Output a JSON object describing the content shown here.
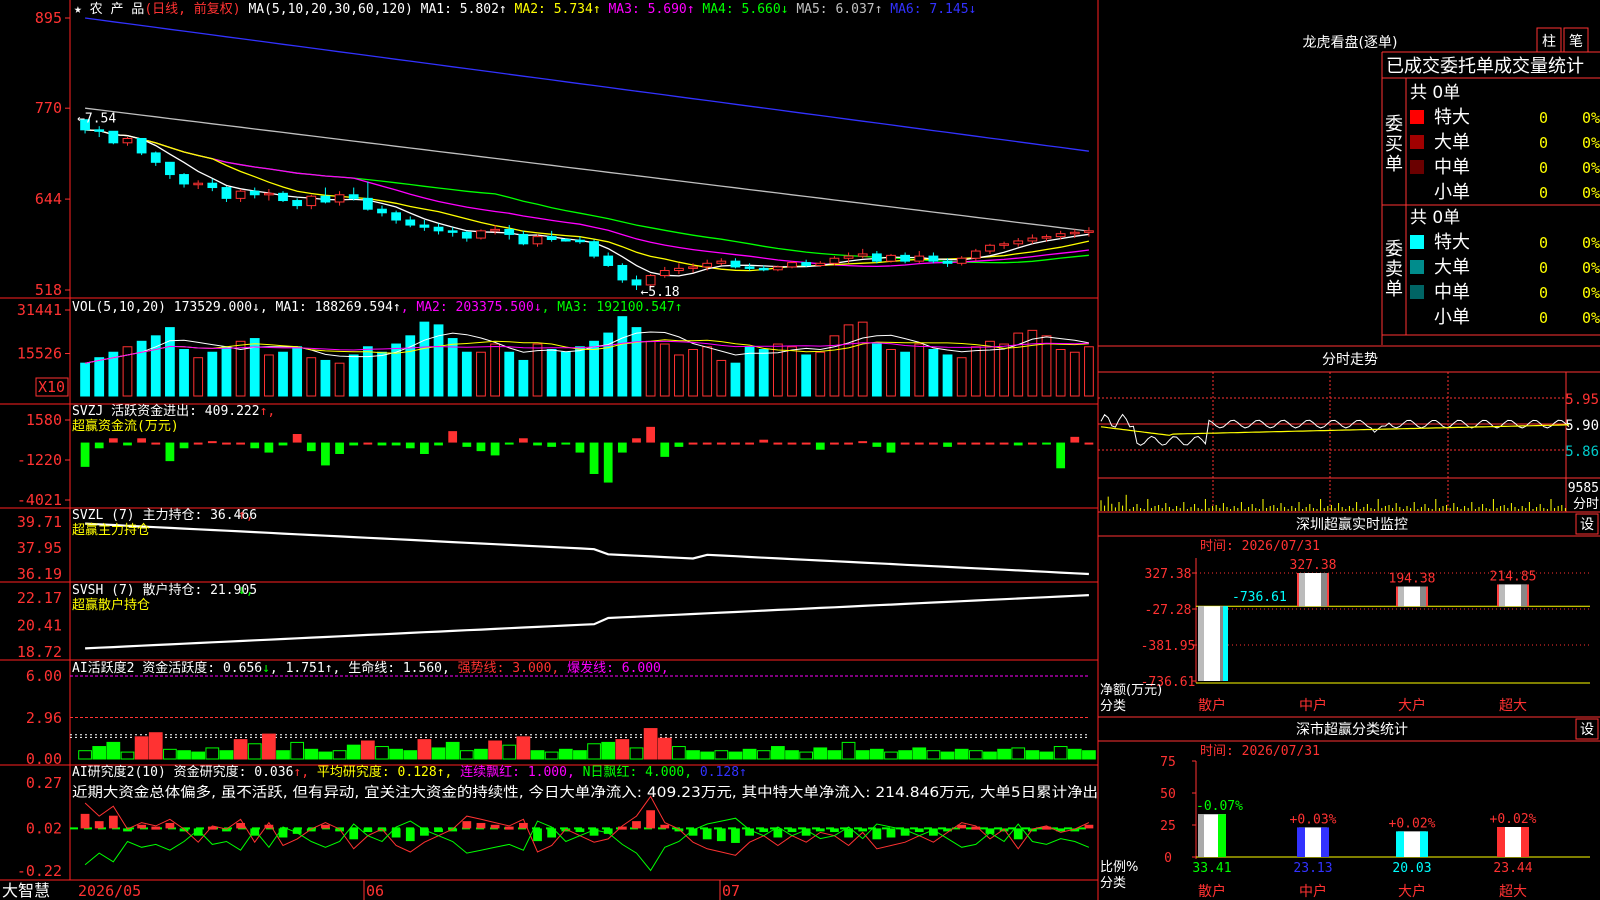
{
  "colors": {
    "up": "#ff3232",
    "down": "#00ffff",
    "red": "#ff3232",
    "grid": "#a00000",
    "yellow": "#ffff00",
    "magenta": "#ff00ff",
    "green": "#00ff00",
    "blue": "#3232ff",
    "white": "#ffffff",
    "gray": "#c0c0c0",
    "border": "#ff2020"
  },
  "main": {
    "header": {
      "mark": "★",
      "title": "农  产  品",
      "period": "(日线, 前复权)",
      "ma_def": "MA(5,10,20,30,60,120)",
      "ma1": "MA1: 5.802",
      "ma2": "MA2: 5.734",
      "ma3": "MA3: 5.690",
      "ma4": "MA4: 5.660",
      "ma5": "MA5: 6.037",
      "ma6": "MA6: 7.145"
    },
    "yticks": [
      "895",
      "770",
      "644",
      "518"
    ],
    "high_marker": "←7.54",
    "low_marker": "←5.18"
  },
  "vol": {
    "header": "VOL(5,10,20)",
    "value": "173529.000",
    "ma1": "MA1: 188269.594",
    "ma2": "MA2: 203375.500",
    "ma3": "MA3: 192100.547",
    "yticks": [
      "31441",
      "15526"
    ],
    "unit": "X10"
  },
  "svzj": {
    "header": "SVZJ  活跃资金进出: 409.222",
    "sub": "超赢资金流(万元)",
    "yticks": [
      "1580",
      "-1220",
      "-4021"
    ]
  },
  "svzl": {
    "header": "SVZL (7) 主力持仓: 36.466",
    "sub": "超赢主力持仓",
    "yticks": [
      "39.71",
      "37.95",
      "36.19"
    ]
  },
  "svsh": {
    "header": "SVSH (7) 散户持仓: 21.905",
    "sub": "超赢散户持仓",
    "yticks": [
      "22.17",
      "20.41",
      "18.72"
    ]
  },
  "ai1": {
    "header": "AI活跃度2 资金活跃度: 0.656",
    "v2": "1.751",
    "v3": "生命线: 1.560",
    "v4": "强势线: 3.000",
    "v5": "爆发线: 6.000",
    "yticks": [
      "6.00",
      "2.96",
      "0.00"
    ]
  },
  "ai2": {
    "header": "AI研究度2(10) 资金研究度: 0.036",
    "v2": "平均研究度: 0.128",
    "v3": "连续飘红: 1.000",
    "v4": "N日飘红: 4.000",
    "v5": "0.128",
    "note": "近期大资金总体偏多, 虽不活跃, 但有异动, 宜关注大资金的持续性, 今日大单净流入: 409.23万元, 其中特大单净流入: 214.846万元, 大单5日累计净出",
    "yticks": [
      "0.27",
      "0.02",
      "-0.22"
    ]
  },
  "xaxis": {
    "brand": "大智慧",
    "labels": [
      "2026/05",
      "06",
      "07"
    ]
  },
  "longhu": {
    "title": "龙虎看盘(逐单)",
    "tabs": [
      "柱",
      "笔"
    ],
    "subtitle": "已成交委托单成交量统计",
    "buy": {
      "side": "委买单",
      "total": "共 0单",
      "rows": [
        {
          "label": "特大",
          "val": "0",
          "pct": "0%",
          "color": "#ff0000"
        },
        {
          "label": "大单",
          "val": "0",
          "pct": "0%",
          "color": "#a00000"
        },
        {
          "label": "中单",
          "val": "0",
          "pct": "0%",
          "color": "#6a0000"
        },
        {
          "label": "小单",
          "val": "0",
          "pct": "0%",
          "color": "#000000"
        }
      ]
    },
    "sell": {
      "side": "委卖单",
      "total": "共 0单",
      "rows": [
        {
          "label": "特大",
          "val": "0",
          "pct": "0%",
          "color": "#00ffff"
        },
        {
          "label": "大单",
          "val": "0",
          "pct": "0%",
          "color": "#008c8c"
        },
        {
          "label": "中单",
          "val": "0",
          "pct": "0%",
          "color": "#006464"
        },
        {
          "label": "小单",
          "val": "0",
          "pct": "0%",
          "color": "#000000"
        }
      ]
    }
  },
  "fenshi": {
    "title": "分时走势",
    "yticks": [
      "5.95",
      "5.90",
      "5.86"
    ],
    "vol_tick": "9585",
    "vol_label": "分时"
  },
  "sz_monitor": {
    "title": "深圳超赢实时监控",
    "set": "设",
    "time": "时间: 2026/07/31",
    "yticks": [
      "327.38",
      "-27.28",
      "-381.95",
      "-736.61"
    ],
    "ylabel1": "净额(万元)",
    "ylabel2": "分类",
    "cats": [
      "散户",
      "中户",
      "大户",
      "超大"
    ],
    "values": [
      -736.61,
      327.38,
      194.38,
      214.85
    ],
    "value_labels": [
      "-736.61",
      "327.38",
      "194.38",
      "214.85"
    ]
  },
  "sz_class": {
    "title": "深市超赢分类统计",
    "set": "设",
    "time": "时间: 2026/07/31",
    "yticks": [
      "75",
      "50",
      "25",
      "0"
    ],
    "ylabel1": "比例%",
    "ylabel2": "分类",
    "cats": [
      "散户",
      "中户",
      "大户",
      "超大"
    ],
    "values": [
      33.41,
      23.13,
      20.03,
      23.44
    ],
    "changes": [
      "-0.07%",
      "+0.03%",
      "+0.02%",
      "+0.02%"
    ],
    "value_labels": [
      "33.41",
      "23.13",
      "20.03",
      "23.44"
    ]
  },
  "chart_data": {
    "type": "candlestick",
    "title": "农  产  品",
    "x_labels": [
      "2026/05",
      "06",
      "07"
    ],
    "ohlc": [
      [
        7.54,
        7.54,
        7.35,
        7.4
      ],
      [
        7.4,
        7.45,
        7.3,
        7.38
      ],
      [
        7.38,
        7.38,
        7.2,
        7.22
      ],
      [
        7.22,
        7.3,
        7.18,
        7.28
      ],
      [
        7.28,
        7.28,
        7.05,
        7.08
      ],
      [
        7.08,
        7.1,
        6.9,
        6.95
      ],
      [
        6.95,
        6.95,
        6.72,
        6.78
      ],
      [
        6.78,
        6.8,
        6.6,
        6.65
      ],
      [
        6.65,
        6.7,
        6.58,
        6.66
      ],
      [
        6.66,
        6.72,
        6.55,
        6.6
      ],
      [
        6.6,
        6.62,
        6.4,
        6.45
      ],
      [
        6.45,
        6.58,
        6.4,
        6.55
      ],
      [
        6.55,
        6.6,
        6.45,
        6.5
      ],
      [
        6.5,
        6.58,
        6.42,
        6.52
      ],
      [
        6.52,
        6.55,
        6.4,
        6.42
      ],
      [
        6.42,
        6.45,
        6.3,
        6.35
      ],
      [
        6.35,
        6.5,
        6.3,
        6.48
      ],
      [
        6.48,
        6.6,
        6.38,
        6.4
      ],
      [
        6.4,
        6.55,
        6.35,
        6.5
      ],
      [
        6.5,
        6.6,
        6.42,
        6.45
      ],
      [
        6.45,
        6.68,
        6.28,
        6.3
      ],
      [
        6.3,
        6.35,
        6.2,
        6.25
      ],
      [
        6.25,
        6.28,
        6.1,
        6.15
      ],
      [
        6.15,
        6.2,
        6.05,
        6.08
      ],
      [
        6.08,
        6.15,
        6.0,
        6.05
      ],
      [
        6.05,
        6.1,
        5.95,
        6.0
      ],
      [
        6.0,
        6.05,
        5.92,
        5.98
      ],
      [
        5.98,
        6.0,
        5.85,
        5.9
      ],
      [
        5.9,
        6.02,
        5.88,
        6.0
      ],
      [
        6.0,
        6.08,
        5.95,
        6.02
      ],
      [
        6.02,
        6.08,
        5.88,
        5.95
      ],
      [
        5.95,
        6.0,
        5.8,
        5.82
      ],
      [
        5.82,
        5.95,
        5.78,
        5.92
      ],
      [
        5.92,
        6.0,
        5.85,
        5.88
      ],
      [
        5.88,
        5.9,
        5.85,
        5.87
      ],
      [
        5.87,
        5.92,
        5.82,
        5.85
      ],
      [
        5.85,
        5.88,
        5.62,
        5.65
      ],
      [
        5.65,
        5.7,
        5.5,
        5.52
      ],
      [
        5.52,
        5.55,
        5.28,
        5.32
      ],
      [
        5.32,
        5.38,
        5.18,
        5.25
      ],
      [
        5.25,
        5.4,
        5.2,
        5.38
      ],
      [
        5.38,
        5.5,
        5.35,
        5.45
      ],
      [
        5.45,
        5.55,
        5.4,
        5.48
      ],
      [
        5.48,
        5.55,
        5.42,
        5.5
      ],
      [
        5.5,
        5.6,
        5.45,
        5.55
      ],
      [
        5.55,
        5.62,
        5.52,
        5.58
      ],
      [
        5.58,
        5.62,
        5.48,
        5.5
      ],
      [
        5.5,
        5.55,
        5.45,
        5.48
      ],
      [
        5.48,
        5.52,
        5.44,
        5.46
      ],
      [
        5.46,
        5.52,
        5.44,
        5.5
      ],
      [
        5.5,
        5.58,
        5.48,
        5.56
      ],
      [
        5.56,
        5.6,
        5.5,
        5.52
      ],
      [
        5.52,
        5.58,
        5.5,
        5.55
      ],
      [
        5.55,
        5.65,
        5.52,
        5.62
      ],
      [
        5.62,
        5.7,
        5.55,
        5.65
      ],
      [
        5.65,
        5.75,
        5.62,
        5.68
      ],
      [
        5.68,
        5.72,
        5.55,
        5.58
      ],
      [
        5.58,
        5.68,
        5.56,
        5.66
      ],
      [
        5.66,
        5.7,
        5.55,
        5.58
      ],
      [
        5.58,
        5.72,
        5.55,
        5.65
      ],
      [
        5.65,
        5.7,
        5.55,
        5.58
      ],
      [
        5.58,
        5.62,
        5.5,
        5.55
      ],
      [
        5.55,
        5.65,
        5.52,
        5.62
      ],
      [
        5.62,
        5.75,
        5.58,
        5.72
      ],
      [
        5.72,
        5.82,
        5.68,
        5.8
      ],
      [
        5.8,
        5.85,
        5.75,
        5.82
      ],
      [
        5.82,
        5.9,
        5.78,
        5.86
      ],
      [
        5.86,
        5.95,
        5.82,
        5.9
      ],
      [
        5.9,
        5.95,
        5.85,
        5.92
      ],
      [
        5.92,
        6.0,
        5.88,
        5.96
      ],
      [
        5.96,
        6.02,
        5.9,
        5.98
      ],
      [
        5.98,
        6.05,
        5.92,
        6.0
      ]
    ],
    "vol_ylim": [
      0,
      31441
    ],
    "svzj_ylim": [
      -4021,
      1580
    ],
    "svzl_ylim": [
      36.19,
      39.71
    ],
    "svsh_ylim": [
      18.72,
      22.17
    ],
    "ai1_ylim": [
      0,
      6
    ],
    "ai2_ylim": [
      -0.22,
      0.27
    ],
    "price_ylim": [
      5.18,
      8.95
    ]
  }
}
